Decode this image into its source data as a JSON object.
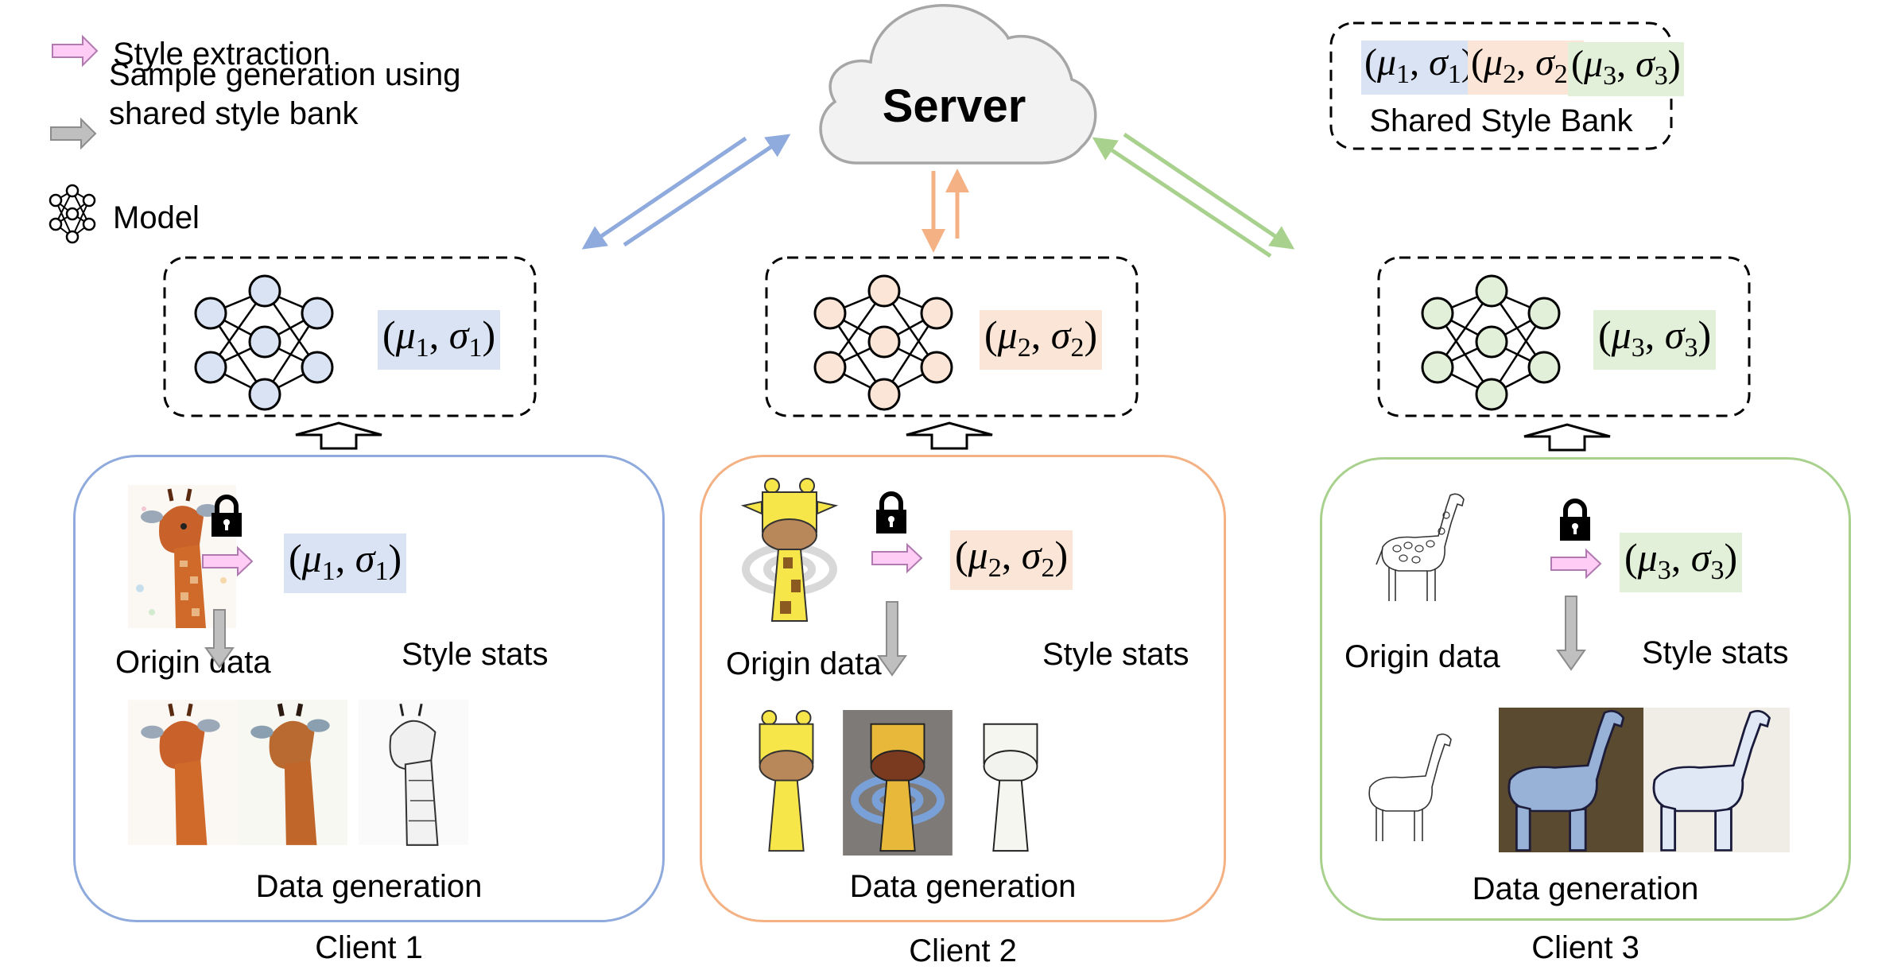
{
  "legend": {
    "items": [
      {
        "icon": "pink-arrow-icon",
        "label": "Style extraction"
      },
      {
        "icon": "gray-arrow-icon",
        "label_line1": "Sample generation using",
        "label_line2": "shared style bank"
      },
      {
        "icon": "neural-network-icon",
        "label": "Model"
      }
    ]
  },
  "server": {
    "label": "Server"
  },
  "style_bank": {
    "title": "Shared Style Bank",
    "entries": [
      {
        "mu": "μ",
        "mu_sub": "1",
        "sigma": "σ",
        "sigma_sub": "1"
      },
      {
        "mu": "μ",
        "mu_sub": "2",
        "sigma": "σ",
        "sigma_sub": "2"
      },
      {
        "mu": "μ",
        "mu_sub": "3",
        "sigma": "σ",
        "sigma_sub": "3"
      }
    ]
  },
  "colors": {
    "client1": "#8faadc",
    "client2": "#f4b183",
    "client3": "#a9d18e",
    "client1_fill": "#dae3f3",
    "client2_fill": "#fbe5d6",
    "client3_fill": "#e2f0d9",
    "style_arrow": "#ffccf5",
    "gen_arrow": "#bfbfbf",
    "cloud_fill": "#f2f2f2",
    "cloud_stroke": "#a6a6a6"
  },
  "clients": [
    {
      "name": "Client 1",
      "origin_label": "Origin data",
      "stats_label": "Style stats",
      "generation_label": "Data generation",
      "stats": {
        "open": "(",
        "mu": "μ",
        "sub": "1",
        "comma": ", ",
        "sigma": "σ",
        "close": ")"
      },
      "origin_image": "watercolor giraffe",
      "generated_images": [
        "watercolor giraffe (style 1)",
        "watercolor giraffe (style 2)",
        "sketch giraffe (style 3)"
      ]
    },
    {
      "name": "Client 2",
      "origin_label": "Origin data",
      "stats_label": "Style stats",
      "generation_label": "Data generation",
      "stats": {
        "open": "(",
        "mu": "μ",
        "sub": "2",
        "comma": ", ",
        "sigma": "σ",
        "close": ")"
      },
      "origin_image": "cartoon giraffe",
      "generated_images": [
        "cartoon giraffe (style 2)",
        "cartoon giraffe (style 1)",
        "cartoon giraffe (style 3)"
      ]
    },
    {
      "name": "Client 3",
      "origin_label": "Origin data",
      "stats_label": "Style stats",
      "generation_label": "Data generation",
      "stats": {
        "open": "(",
        "mu": "μ",
        "sub": "3",
        "comma": ", ",
        "sigma": "σ",
        "close": ")"
      },
      "origin_image": "line-sketch giraffe",
      "generated_images": [
        "line-sketch giraffe (style 3)",
        "line-sketch giraffe (style 1)",
        "line-sketch giraffe (style 2)"
      ]
    }
  ]
}
